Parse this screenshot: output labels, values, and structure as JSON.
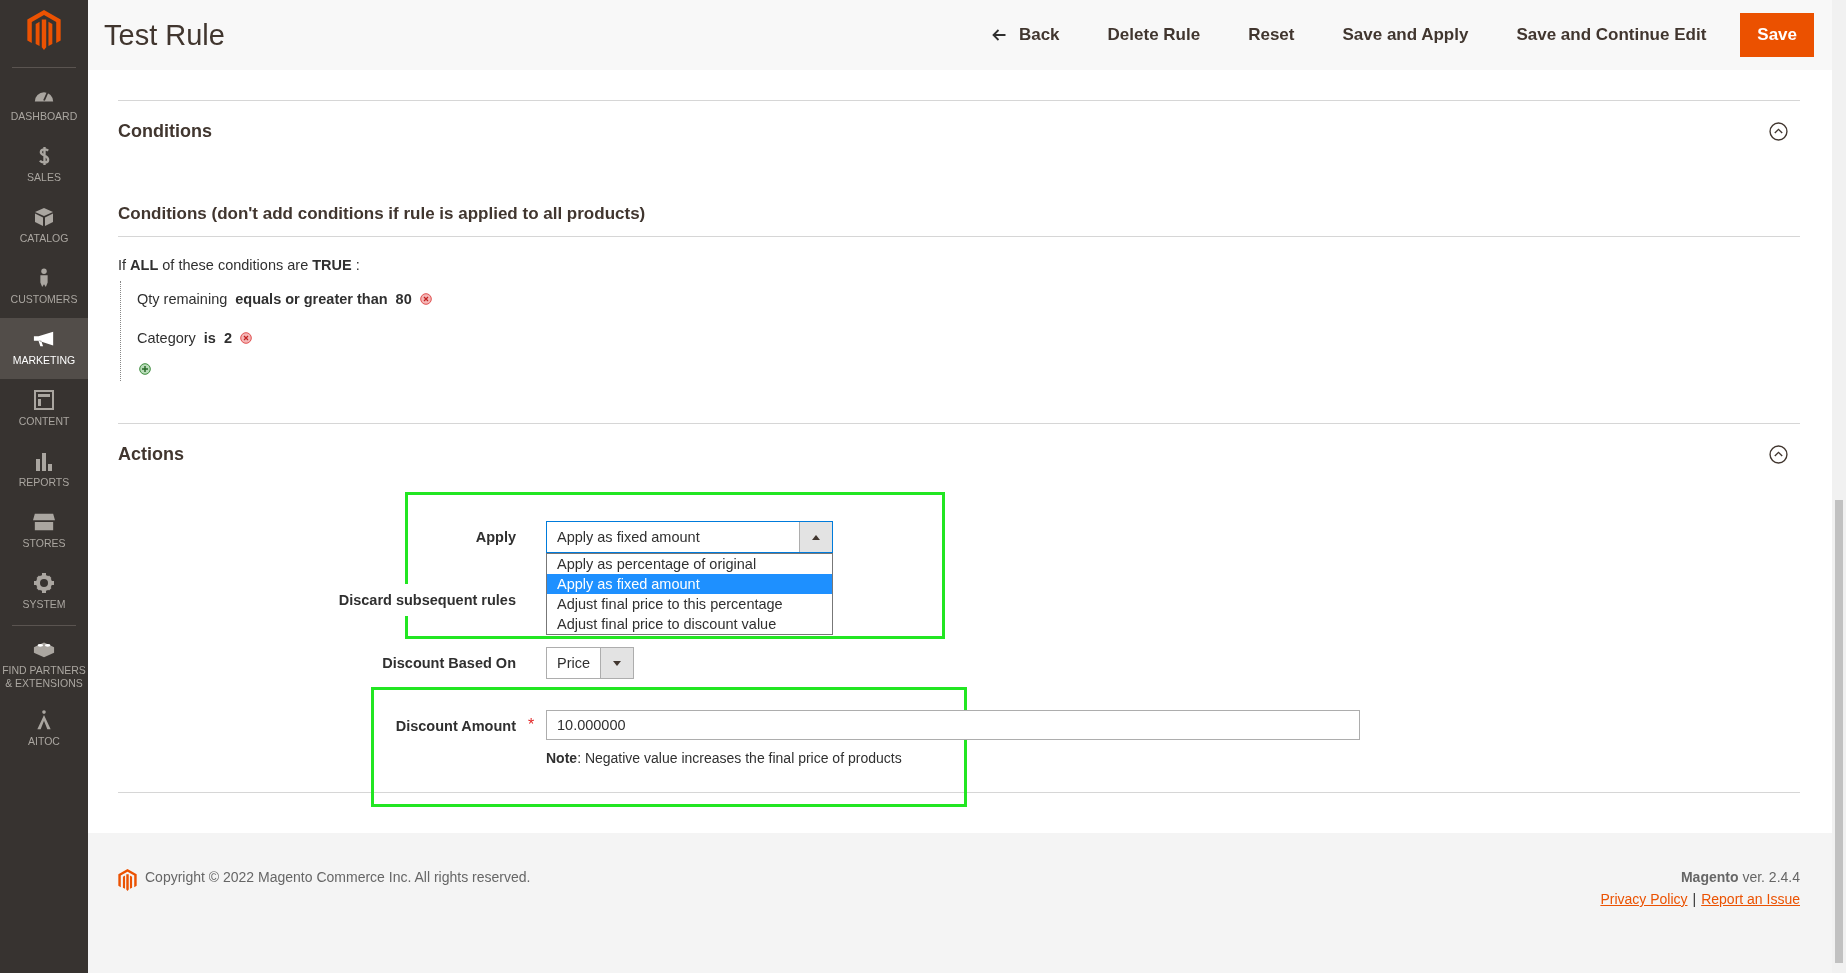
{
  "sidebar": {
    "items": [
      {
        "label": "DASHBOARD",
        "selected": false
      },
      {
        "label": "SALES",
        "selected": false
      },
      {
        "label": "CATALOG",
        "selected": false
      },
      {
        "label": "CUSTOMERS",
        "selected": false
      },
      {
        "label": "MARKETING",
        "selected": true
      },
      {
        "label": "CONTENT",
        "selected": false
      },
      {
        "label": "REPORTS",
        "selected": false
      },
      {
        "label": "STORES",
        "selected": false
      },
      {
        "label": "SYSTEM",
        "selected": false
      },
      {
        "label": "FIND PARTNERS & EXTENSIONS",
        "selected": false
      },
      {
        "label": "AITOC",
        "selected": false
      }
    ]
  },
  "page_title": "Test Rule",
  "header_actions": [
    {
      "label": "Back",
      "kind": "back"
    },
    {
      "label": "Delete Rule",
      "kind": "link"
    },
    {
      "label": "Reset",
      "kind": "link"
    },
    {
      "label": "Save and Apply",
      "kind": "link"
    },
    {
      "label": "Save and Continue Edit",
      "kind": "link"
    },
    {
      "label": "Save",
      "kind": "primary"
    }
  ],
  "conditions": {
    "title": "Conditions",
    "expanded": true,
    "subtitle": "Conditions (don't add conditions if rule is applied to all products)",
    "intro": "If **ALL**  of these conditions are **TRUE** :",
    "rules": [
      {
        "attribute": "Qty remaining",
        "operator": "equals or greater than",
        "value": "80"
      },
      {
        "attribute": "Category",
        "operator": "is",
        "value": "2"
      }
    ]
  },
  "actions": {
    "title": "Actions",
    "expanded": true,
    "apply": {
      "label": "Apply",
      "value": "Apply as fixed amount",
      "expanded": true,
      "options": [
        {
          "label": "Apply as percentage of original",
          "selected": false
        },
        {
          "label": "Apply as fixed amount",
          "selected": true
        },
        {
          "label": "Adjust final price to this percentage",
          "selected": false
        },
        {
          "label": "Adjust final price to discount value",
          "selected": false
        }
      ]
    },
    "discard_label": "Discard subsequent rules",
    "based_on": {
      "label": "Discount Based On",
      "value": "Price"
    },
    "amount": {
      "label": "Discount Amount",
      "required_mark": "*",
      "value": "10.000000",
      "note": "**Note**: Negative value increases the final price of products"
    }
  },
  "footer": {
    "copyright": "Copyright © 2022 Magento Commerce Inc. All rights reserved.",
    "version": "**Magento** ver. 2.4.4",
    "links": [
      "Privacy Policy",
      "Report an Issue"
    ],
    "separator": "|"
  }
}
